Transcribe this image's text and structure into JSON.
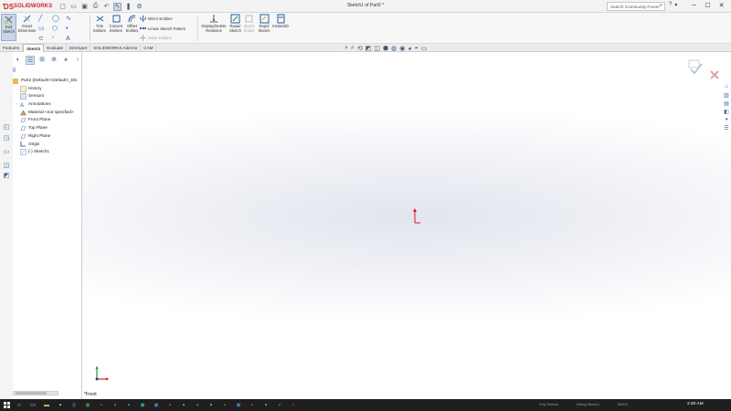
{
  "titlebar": {
    "brand": "SOLIDWORKS",
    "document_title": "Sketch1 of Part2 *",
    "search_placeholder": "Search Community Forum",
    "icons": [
      "new-icon",
      "open-icon",
      "save-icon",
      "print-icon",
      "undo-icon",
      "select-icon",
      "rebuild-icon",
      "options-icon"
    ]
  },
  "ribbon": {
    "exit_sketch": "Exit Sketch",
    "smart_dimension": "Smart Dimension",
    "trim_entities": "Trim Entities",
    "convert_entities": "Convert Entities",
    "offset_entities": "Offset Entities",
    "mirror_entities": "Mirror Entities",
    "linear_sketch_pattern": "Linear Sketch Pattern",
    "move_entities": "Move Entities",
    "display_delete_relations": "Display/Delete Relations",
    "repair_sketch": "Repair Sketch",
    "quick_snaps": "Quick Snaps",
    "rapid_sketch": "Rapid Sketch",
    "instant2d": "Instant2D"
  },
  "tabs": [
    {
      "label": "Features",
      "active": false
    },
    {
      "label": "Sketch",
      "active": true
    },
    {
      "label": "Evaluate",
      "active": false
    },
    {
      "label": "DimXpert",
      "active": false
    },
    {
      "label": "SOLIDWORKS Add-Ins",
      "active": false
    },
    {
      "label": "CAM",
      "active": false
    }
  ],
  "tree": {
    "root": "Part2 (Default<<Default>_Dis",
    "items": [
      {
        "label": "History",
        "icon": "history-icon"
      },
      {
        "label": "Sensors",
        "icon": "sensors-icon"
      },
      {
        "label": "Annotations",
        "icon": "annotations-icon"
      },
      {
        "label": "Material <not specified>",
        "icon": "material-icon"
      },
      {
        "label": "Front Plane",
        "icon": "plane-icon"
      },
      {
        "label": "Top Plane",
        "icon": "plane-icon"
      },
      {
        "label": "Right Plane",
        "icon": "plane-icon"
      },
      {
        "label": "Origin",
        "icon": "origin-icon"
      },
      {
        "label": "(-) Sketch1",
        "icon": "sketch-icon"
      }
    ]
  },
  "viewport": {
    "view_label": "*Front"
  },
  "taskbar": {
    "status": [
      "Fully Defined",
      "Editing Sketch1",
      "MMGS"
    ],
    "clock": "2:40 AM"
  },
  "colors": {
    "brand_red": "#d2232a",
    "accent_blue": "#1d5fa8",
    "origin_red": "#e0141e"
  }
}
